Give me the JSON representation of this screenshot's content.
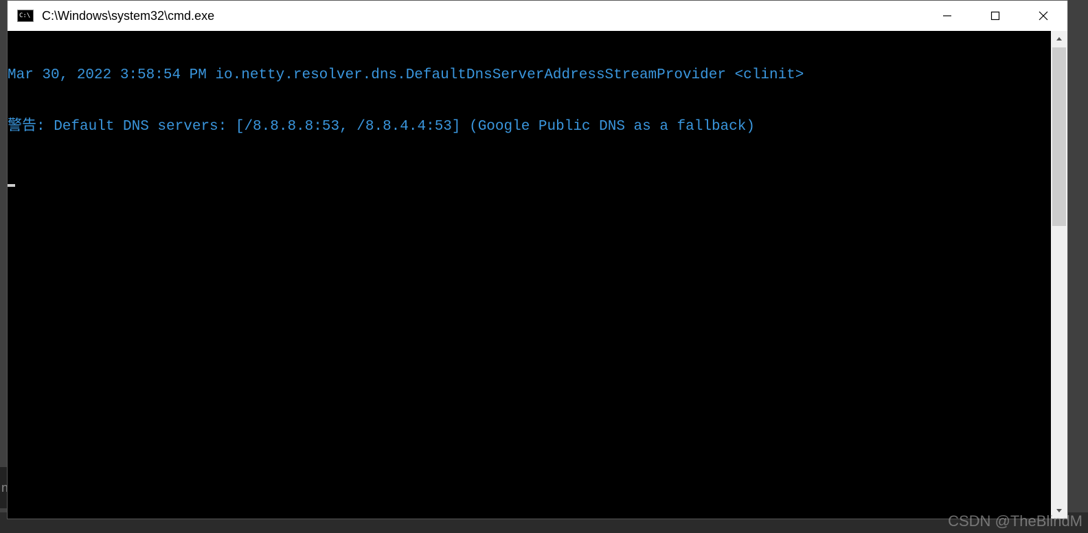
{
  "window": {
    "title": "C:\\Windows\\system32\\cmd.exe",
    "icon_name": "cmd-icon"
  },
  "console": {
    "lines": [
      "Mar 30, 2022 3:58:54 PM io.netty.resolver.dns.DefaultDnsServerAddressStreamProvider <clinit>",
      "警告: Default DNS servers: [/8.8.8.8:53, /8.8.4.4:53] (Google Public DNS as a fallback)"
    ],
    "text_color": "#3a96dd",
    "background_color": "#000000"
  },
  "watermark": "CSDN @TheBlindM",
  "background_partial_text": "n"
}
